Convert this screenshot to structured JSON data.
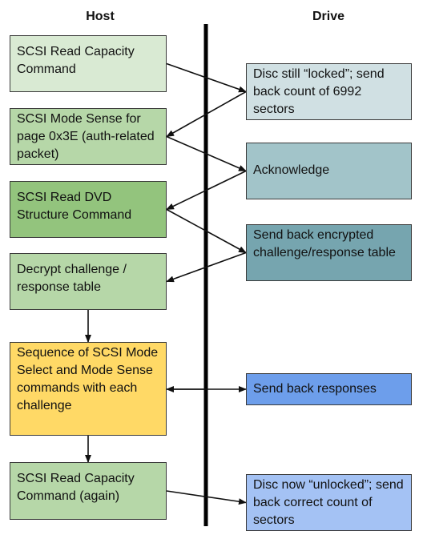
{
  "headers": {
    "host": "Host",
    "drive": "Drive"
  },
  "host_steps": [
    {
      "id": "h1",
      "text": "SCSI Read Capacity Command",
      "color": "#d9ead3"
    },
    {
      "id": "h2",
      "text": "SCSI Mode Sense for page 0x3E (auth-related packet)",
      "color": "#b6d7a8"
    },
    {
      "id": "h3",
      "text": "SCSI Read DVD Structure Command",
      "color": "#93c47d"
    },
    {
      "id": "h4",
      "text": "Decrypt challenge / response table",
      "color": "#b6d7a8"
    },
    {
      "id": "h5",
      "text": "Sequence of SCSI Mode Select and Mode Sense commands with each challenge",
      "color": "#ffd966"
    },
    {
      "id": "h6",
      "text": "SCSI Read Capacity Command (again)",
      "color": "#b6d7a8"
    }
  ],
  "drive_steps": [
    {
      "id": "d1",
      "text": "Disc still “locked”; send back count of 6992 sectors",
      "color": "#d0e0e3"
    },
    {
      "id": "d2",
      "text": "Acknowledge",
      "color": "#a2c4c9"
    },
    {
      "id": "d3",
      "text": "Send back encrypted challenge/response table",
      "color": "#76a5af"
    },
    {
      "id": "d4",
      "text": "Send back responses",
      "color": "#6d9eeb"
    },
    {
      "id": "d5",
      "text": "Disc now “unlocked”; send back correct count of sectors",
      "color": "#a4c2f4"
    }
  ],
  "connections": [
    {
      "from": "h1",
      "to": "d1"
    },
    {
      "from": "d1",
      "to": "h2"
    },
    {
      "from": "h2",
      "to": "d2"
    },
    {
      "from": "d2",
      "to": "h3"
    },
    {
      "from": "h3",
      "to": "d3"
    },
    {
      "from": "d3",
      "to": "h4"
    },
    {
      "from": "h4",
      "to": "h5"
    },
    {
      "from": "h5",
      "to": "d4",
      "bidirectional": true
    },
    {
      "from": "h5",
      "to": "h6"
    },
    {
      "from": "h6",
      "to": "d5"
    }
  ]
}
